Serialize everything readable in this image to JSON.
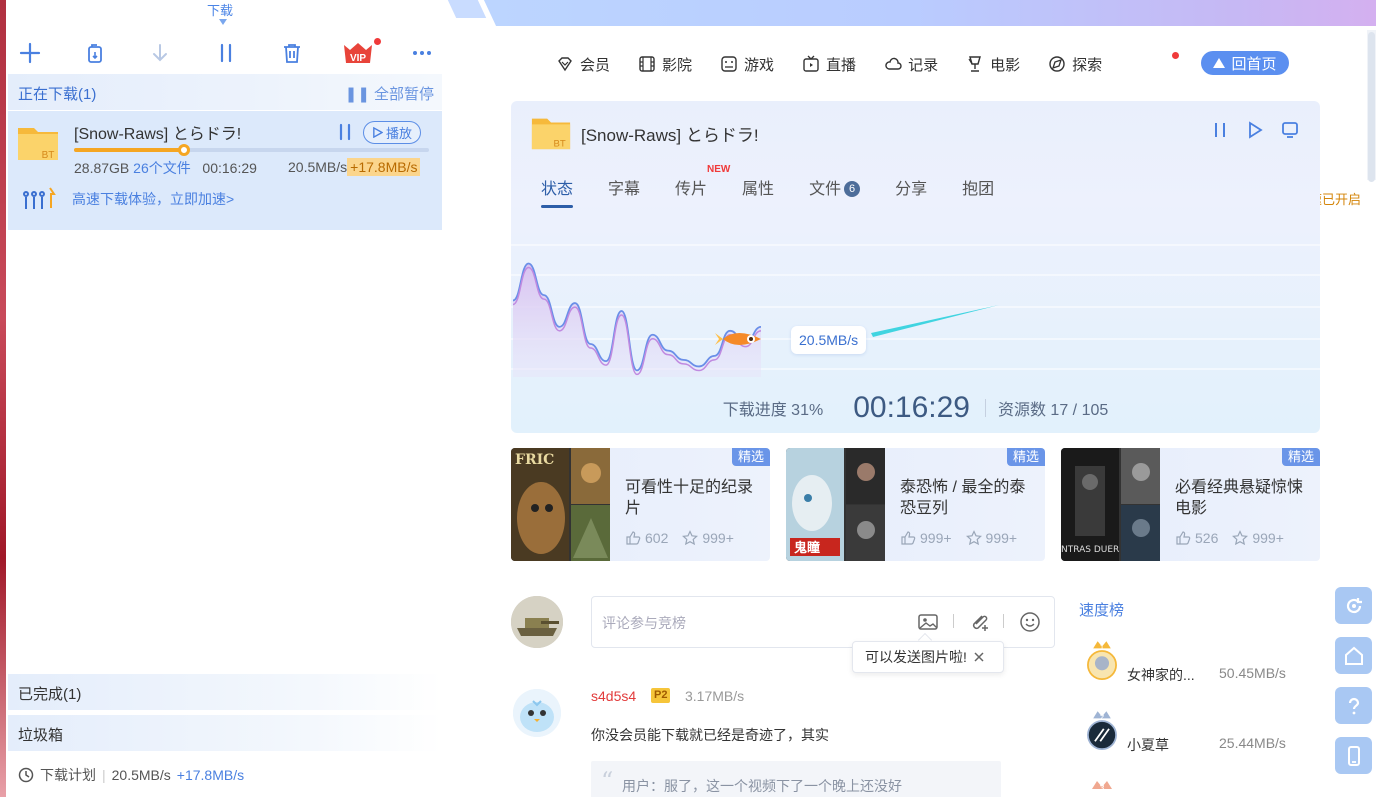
{
  "toolbar": {
    "active_tab": "下载",
    "icons": [
      "plus-icon",
      "copy-link-icon",
      "download-arrow-icon",
      "pause-all-icon",
      "trash-icon",
      "vip-icon",
      "more-icon"
    ],
    "vip_label": "VIP"
  },
  "downloading": {
    "header": "正在下载(1)",
    "pause_all": "全部暂停",
    "item": {
      "name": "[Snow-Raws] とらドラ!",
      "type_badge": "BT",
      "play_label": "播放",
      "size": "28.87GB",
      "files": "26个文件",
      "time_left": "00:16:29",
      "speed": "20.5MB/s",
      "boost": "+17.8MB/s",
      "progress": 0.31,
      "accel_text": "高速下载体验，立即加速>",
      "accel_status": "超级加速已开启"
    }
  },
  "completed": "已完成(1)",
  "trash": "垃圾箱",
  "bottom": {
    "plan": "下载计划",
    "speed": "20.5MB/s",
    "boost": "+17.8MB/s"
  },
  "nav": {
    "items": [
      "会员",
      "影院",
      "游戏",
      "直播",
      "记录",
      "电影",
      "探索"
    ],
    "home": "回首页"
  },
  "detail": {
    "title": "[Snow-Raws] とらドラ!",
    "type_badge": "BT",
    "tabs": [
      "状态",
      "字幕",
      "传片",
      "属性",
      "文件",
      "分享",
      "抱团"
    ],
    "new_tag": "NEW",
    "file_count": "6",
    "speed_bubble": "20.5MB/s",
    "progress_label": "下载进度 31%",
    "time": "00:16:29",
    "sources": "资源数 17 / 105"
  },
  "speed_chart": {
    "series": [
      0.58,
      0.86,
      0.62,
      0.38,
      0.56,
      0.25,
      0.12,
      0.5,
      0.05,
      0.32,
      0.2,
      0.13,
      0.08,
      0.16,
      0.35,
      0.26,
      0.38
    ]
  },
  "recommend": [
    {
      "tag": "精选",
      "title": "可看性十足的纪录片",
      "likes": "602",
      "stars": "999+",
      "poster": "FRIC"
    },
    {
      "tag": "精选",
      "title": "泰恐怖 / 最全的泰恐豆列",
      "likes": "999+",
      "stars": "999+",
      "poster": "鬼瞳"
    },
    {
      "tag": "精选",
      "title": "必看经典悬疑惊悚电影",
      "likes": "526",
      "stars": "999+",
      "poster": "NTRAS DUER"
    }
  ],
  "comment": {
    "placeholder": "评论参与竞榜",
    "tip": "可以发送图片啦!",
    "user": "s4d5s4",
    "badge": "P2",
    "user_speed": "3.17MB/s",
    "text": "你没会员能下载就已经是奇迹了，其实",
    "quote": "用户：服了，这一个视频下了一个晚上还没好"
  },
  "rank": {
    "title": "速度榜",
    "items": [
      {
        "no": "1",
        "name": "女神家的...",
        "speed": "50.45MB/s"
      },
      {
        "no": "2",
        "name": "小夏草",
        "speed": "25.44MB/s"
      },
      {
        "no": "3",
        "name": "",
        "speed": ""
      }
    ]
  },
  "colors": {
    "accent": "#4a80e0",
    "progress": "#f5a623",
    "card_bg": "#e9effc",
    "float_btn": "#a9c8f3"
  }
}
